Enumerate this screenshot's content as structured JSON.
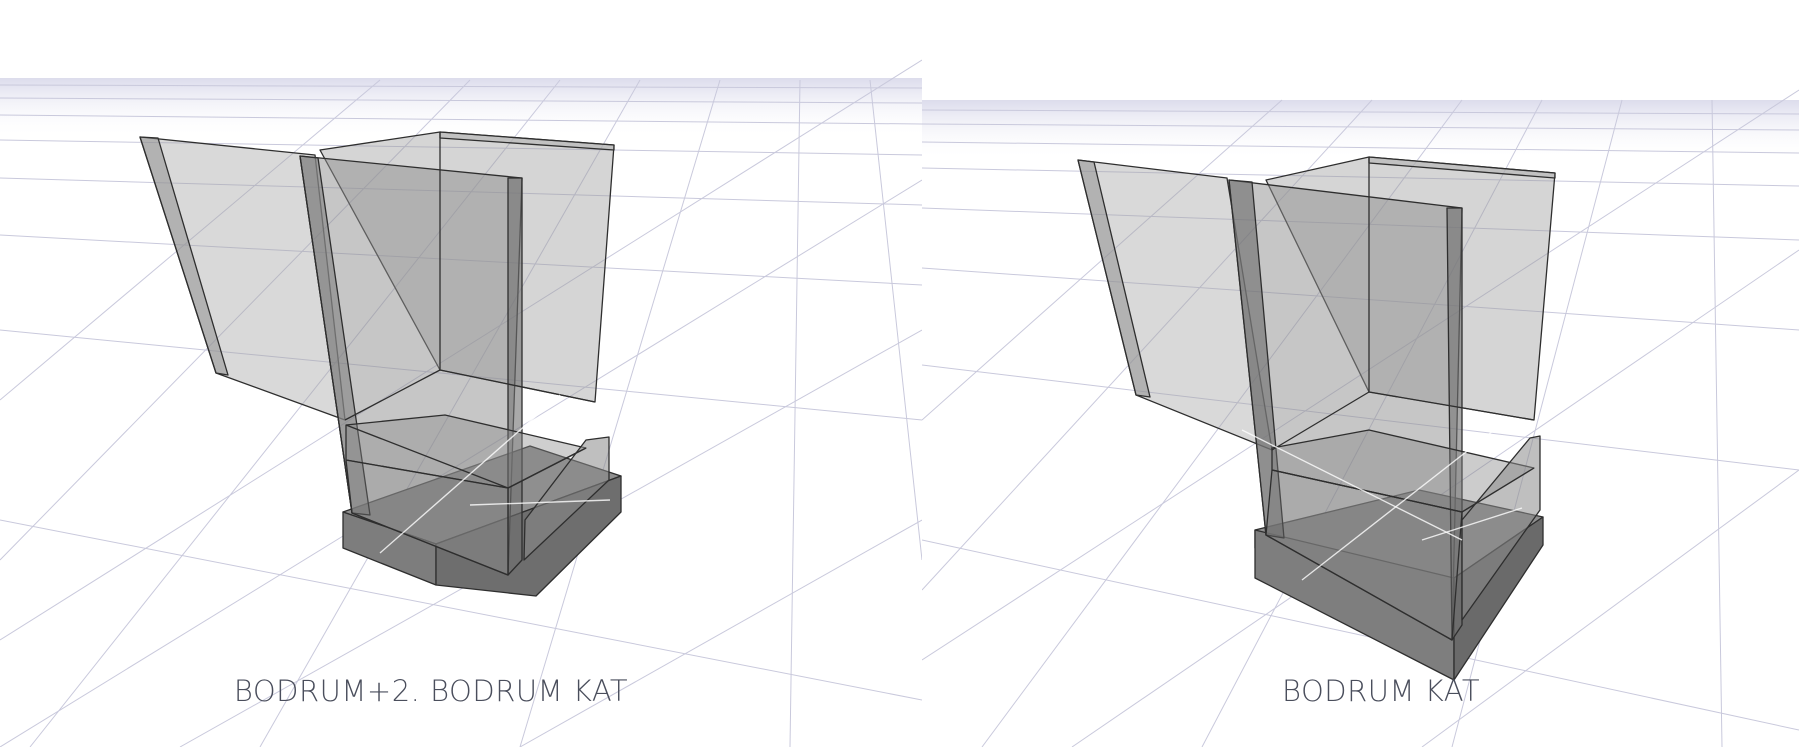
{
  "views": [
    {
      "id": "left",
      "caption": "BODRUM+2. BODRUM KAT"
    },
    {
      "id": "right",
      "caption": "BODRUM KAT"
    }
  ],
  "colors": {
    "background": "#ffffff",
    "grid_line": "#c9c9dc",
    "horizon_haze": "#e6e6f2",
    "solid_fill": "#8a8a8a",
    "glass_fill": "#9a9a9a",
    "edge": "#2e2e2e",
    "caption_text": "#4a4e5c"
  }
}
